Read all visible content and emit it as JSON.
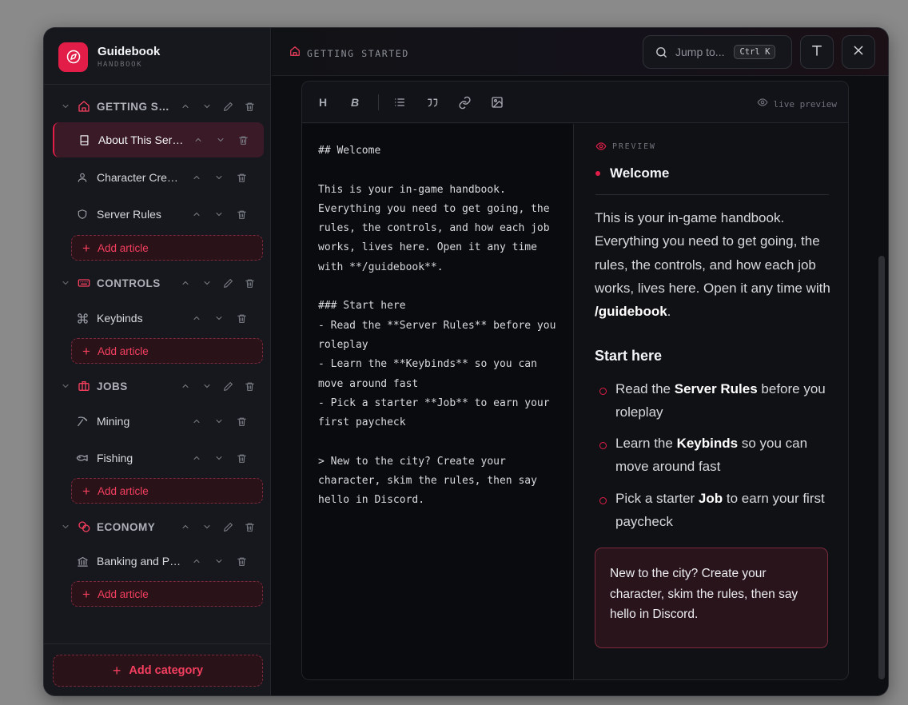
{
  "brand": {
    "title": "Guidebook",
    "subtitle": "HANDBOOK"
  },
  "sidebar": {
    "categories": [
      {
        "label": "GETTING STARTED",
        "articles": [
          {
            "label": "About This Server",
            "icon": "book-icon",
            "active": true
          },
          {
            "label": "Character Creation",
            "icon": "user-icon"
          },
          {
            "label": "Server Rules",
            "icon": "shield-icon"
          }
        ],
        "add_label": "Add article"
      },
      {
        "label": "CONTROLS",
        "articles": [
          {
            "label": "Keybinds",
            "icon": "command-icon"
          }
        ],
        "add_label": "Add article"
      },
      {
        "label": "JOBS",
        "articles": [
          {
            "label": "Mining",
            "icon": "pickaxe-icon"
          },
          {
            "label": "Fishing",
            "icon": "fish-icon"
          }
        ],
        "add_label": "Add article"
      },
      {
        "label": "ECONOMY",
        "articles": [
          {
            "label": "Banking and Payments",
            "icon": "bank-icon"
          }
        ],
        "add_label": "Add article"
      }
    ],
    "add_category_label": "Add category"
  },
  "topbar": {
    "breadcrumb": "GETTING STARTED",
    "search_placeholder": "Jump to...",
    "shortcut": "Ctrl K"
  },
  "toolbar": {
    "heading": "H",
    "bold": "B",
    "live_preview": "live preview"
  },
  "source_lines": [
    "## Welcome",
    "",
    "This is your in-game handbook.",
    "Everything you need to get going, the",
    "rules, the controls, and how each job",
    "works, lives here. Open it any time",
    "with **/guidebook**.",
    "",
    "### Start here",
    "- Read the **Server Rules** before you",
    "roleplay",
    "- Learn the **Keybinds** so you can",
    "move around fast",
    "- Pick a starter **Job** to earn your",
    "first paycheck",
    "",
    "> New to the city? Create your",
    "character, skim the rules, then say",
    "hello in Discord."
  ],
  "preview": {
    "label": "PREVIEW",
    "heading": "Welcome",
    "paragraph_before": "This is your in-game handbook. Everything you need to get going, the rules, the controls, and how each job works, lives here. Open it any time with ",
    "paragraph_bold": "/guidebook",
    "paragraph_after": ".",
    "subheading": "Start here",
    "list": [
      {
        "before": "Read the ",
        "bold": "Server Rules",
        "after": " before you roleplay"
      },
      {
        "before": "Learn the ",
        "bold": "Keybinds",
        "after": " so you can move around fast"
      },
      {
        "before": "Pick a starter ",
        "bold": "Job",
        "after": " to earn your first paycheck"
      }
    ],
    "quote": "New to the city? Create your character, skim the rules, then say hello in Discord."
  },
  "colors": {
    "accent": "#e11d48",
    "accent_light": "#f43f5e",
    "background": "#0c0d10",
    "sidebar": "#16181d"
  }
}
